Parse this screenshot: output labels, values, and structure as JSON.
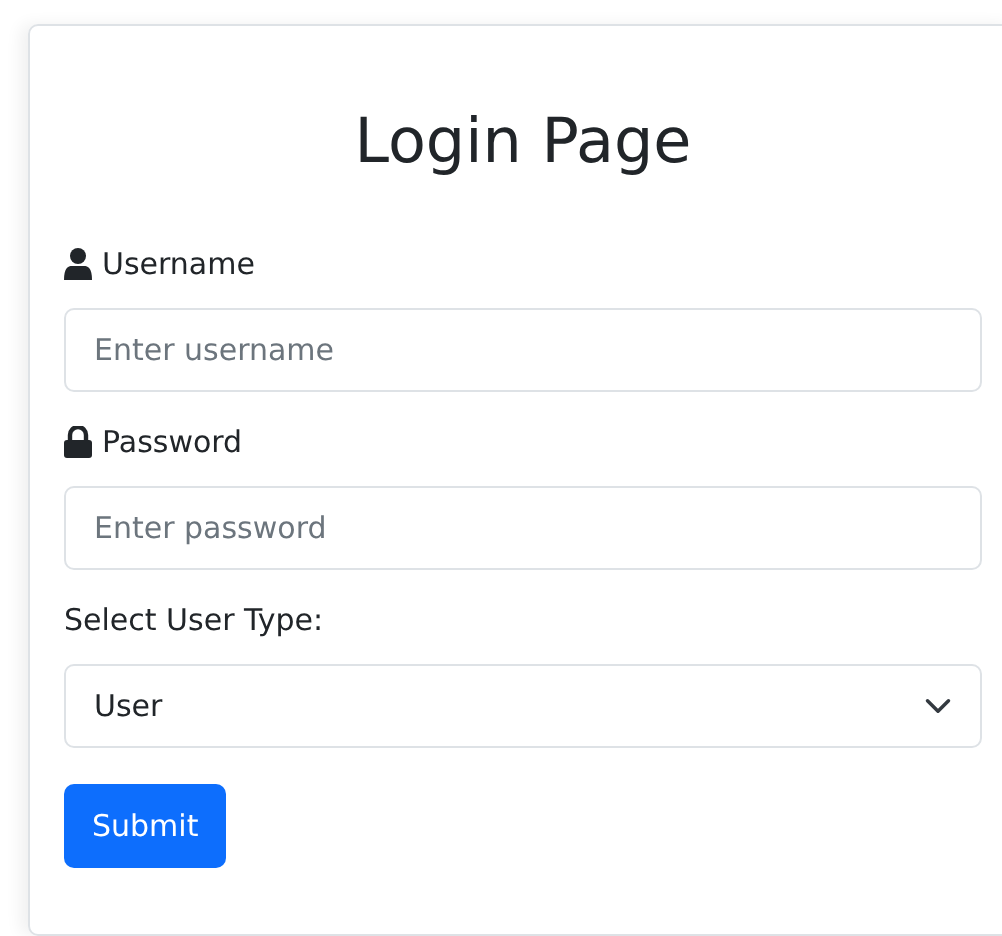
{
  "title": "Login Page",
  "fields": [
    {
      "kind": "text",
      "label": "Username",
      "placeholder": "Enter username"
    },
    {
      "kind": "password",
      "label": "Password",
      "placeholder": "Enter password"
    },
    {
      "kind": "select",
      "label": "Select User Type:",
      "value": "User"
    }
  ],
  "submit": "Submit"
}
